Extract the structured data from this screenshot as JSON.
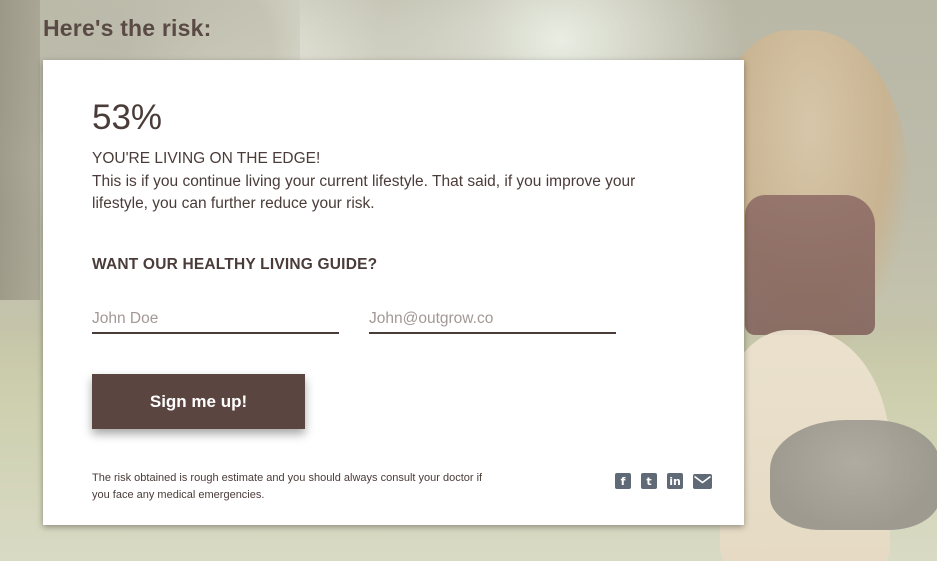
{
  "page": {
    "heading": "Here's the risk:"
  },
  "result": {
    "percent": "53%",
    "headline": "YOU'RE LIVING ON THE EDGE!",
    "description": "This is if you continue living your current lifestyle. That said, if you improve your lifestyle, you can further reduce your risk."
  },
  "form": {
    "title": "WANT OUR HEALTHY LIVING GUIDE?",
    "name_placeholder": "John Doe",
    "email_placeholder": "John@outgrow.co",
    "submit_label": "Sign me up!"
  },
  "footer": {
    "disclaimer": "The risk obtained is rough estimate and you should always consult your doctor if you face any medical emergencies.",
    "social": [
      {
        "icon": "facebook-icon",
        "glyph": "f"
      },
      {
        "icon": "twitter-icon",
        "glyph": "t"
      },
      {
        "icon": "linkedin-icon",
        "glyph": "in"
      },
      {
        "icon": "email-icon"
      }
    ]
  },
  "colors": {
    "text": "#4a3c38",
    "button": "#5b4541",
    "social": "#606a77"
  }
}
